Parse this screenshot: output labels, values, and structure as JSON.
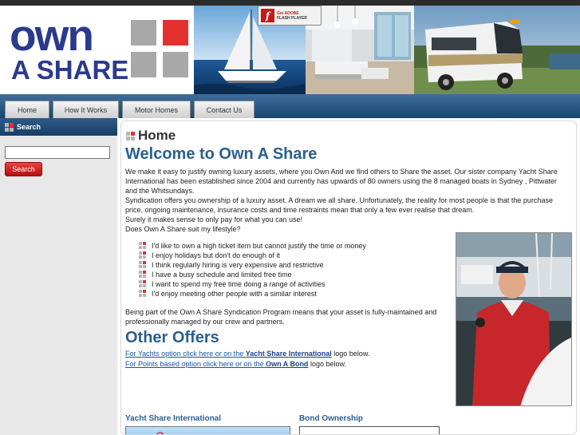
{
  "header": {
    "logo": {
      "line1": "own",
      "line2": "A SHARE",
      "colors": {
        "text": "#2b3a8c",
        "red": "#e53030",
        "gray": "#a8a8a8"
      }
    },
    "flash_badge": {
      "line1": "Get ADOBE",
      "line2": "FLASH PLAYER",
      "icon": "flash-player-icon"
    }
  },
  "nav": {
    "tabs": [
      {
        "label": "Home"
      },
      {
        "label": "How It Works"
      },
      {
        "label": "Motor Homes"
      },
      {
        "label": "Contact Us"
      }
    ]
  },
  "sidebar": {
    "title": "Search",
    "search_value": "",
    "button_label": "Search"
  },
  "main": {
    "page_heading": "Home",
    "welcome_title": "Welcome to Own A Share",
    "intro": "We make it easy to justify owning luxury assets, where you Own And we find others to Share the asset. Our sister company Yacht Share International has been established since 2004 and currently has upwards of 80 owners using the 8 managed boats in Sydney , Pittwater and the Whitsundays.",
    "syndication": "Syndication offers you ownership of a luxury asset. A dream we all share. Unfortunately, the reality for most people is that the purchase price, ongoing maintenance, insurance costs and time restraints mean that only a few ever realise that dream.",
    "surely": "Surely it makes sense to only pay for what you can use!",
    "question": "Does Own A Share suit my lifestyle?",
    "bullets": [
      "I'd like to own a high ticket item but cannot justify the time or money",
      "I enjoy holidays but don't do enough of it",
      "I think regularly hiring is very expensive and restrictive",
      "I have a busy schedule and limited free time",
      "I want to spend my free time doing a range of activities",
      "I'd enjoy meeting other people with a similar interest"
    ],
    "program": "Being part of the Own A Share Syndication Program means that your asset is fully-maintained and professionally managed by our crew and partners.",
    "other_offers_title": "Other Offers",
    "yachts_link": "For Yachts  option click here or on the ",
    "yachts_bold": "Yacht Share International",
    "yachts_tail": " logo below.",
    "points_link": "For Points based option click here or on the ",
    "points_bold": "Own A Bond",
    "points_tail": " logo below.",
    "section_yacht": "Yacht Share International",
    "section_bond": "Bond Ownership"
  }
}
